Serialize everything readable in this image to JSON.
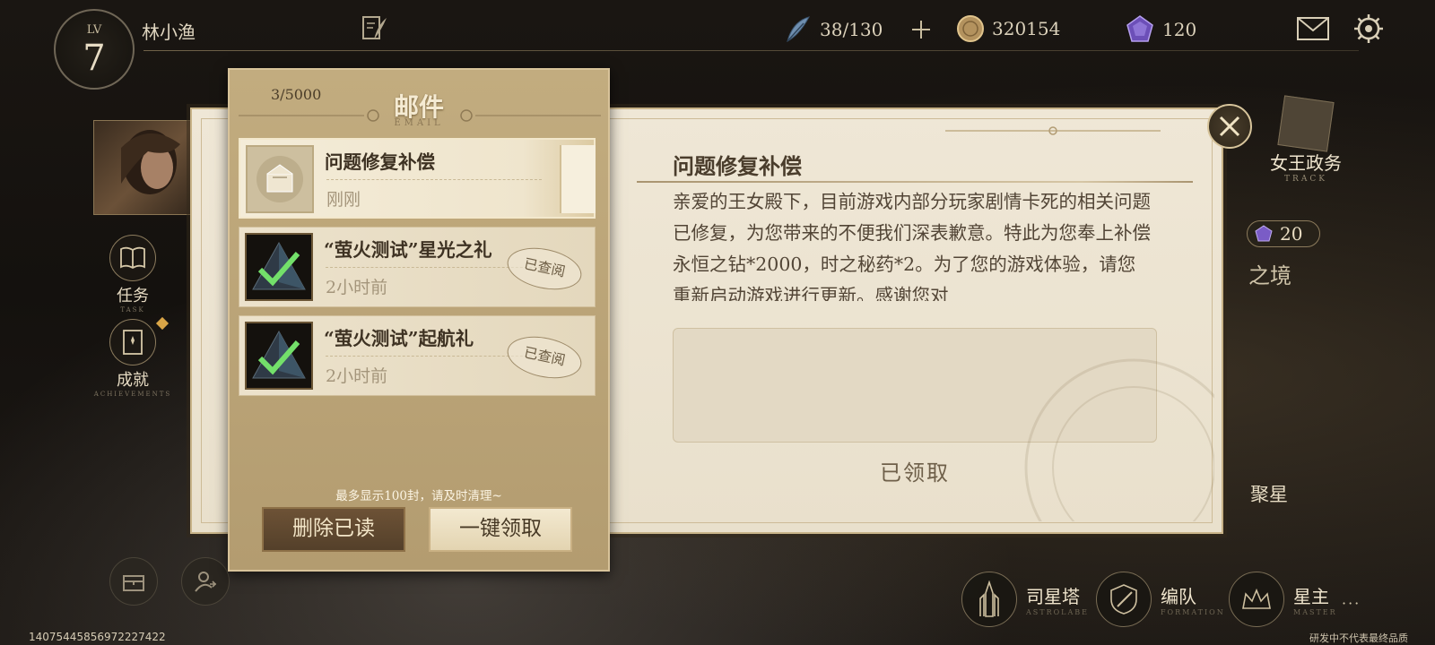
{
  "player": {
    "level_label": "LV",
    "level": "7",
    "name": "林小渔"
  },
  "resources": {
    "stamina": "38/130",
    "coins": "320154",
    "gems": "120"
  },
  "side_menu": {
    "tasks_label": "任务",
    "tasks_sub": "TASK",
    "achievements_label": "成就",
    "achievements_sub": "ACHIEVEMENTS"
  },
  "right_menu": {
    "queen_affairs_label": "女王政务",
    "queen_affairs_sub": "TRACK",
    "gem_cost": "20",
    "realm_label_partial": "之境",
    "gather_label_partial": "聚星"
  },
  "bottom_nav": [
    {
      "label": "司星塔",
      "sub": "ASTROLABE",
      "icon": "tower-icon"
    },
    {
      "label": "编队",
      "sub": "FORMATION",
      "icon": "shield-sword-icon"
    },
    {
      "label": "星主",
      "sub": "MASTER",
      "icon": "crown-icon"
    }
  ],
  "mail": {
    "count": "3/5000",
    "title": "邮件",
    "title_sub": "EMAIL",
    "items": [
      {
        "name": "问题修复补偿",
        "time": "刚刚",
        "read": false
      },
      {
        "name": "“萤火测试”星光之礼",
        "time": "2小时前",
        "read": true,
        "status": "已查阅"
      },
      {
        "name": "“萤火测试”起航礼",
        "time": "2小时前",
        "read": true,
        "status": "已查阅"
      }
    ],
    "footnote": "最多显示100封，请及时清理~",
    "delete_read_label": "删除已读",
    "claim_all_label": "一键领取"
  },
  "detail": {
    "title": "问题修复补偿",
    "body": "亲爱的王女殿下，目前游戏内部分玩家剧情卡死的相关问题已修复，为您带来的不便我们深表歉意。特此为您奉上补偿永恒之钻*2000，时之秘药*2。为了您的游戏体验，请您重新启动游戏进行更新。感谢您对",
    "claimed_label": "已领取"
  },
  "uid": "14075445856972227422",
  "disclaimer": "研发中不代表最终品质",
  "colors": {
    "panel_gold": "#c2ac7f",
    "paper": "#efe7d6",
    "accent_dark": "#54402a"
  }
}
